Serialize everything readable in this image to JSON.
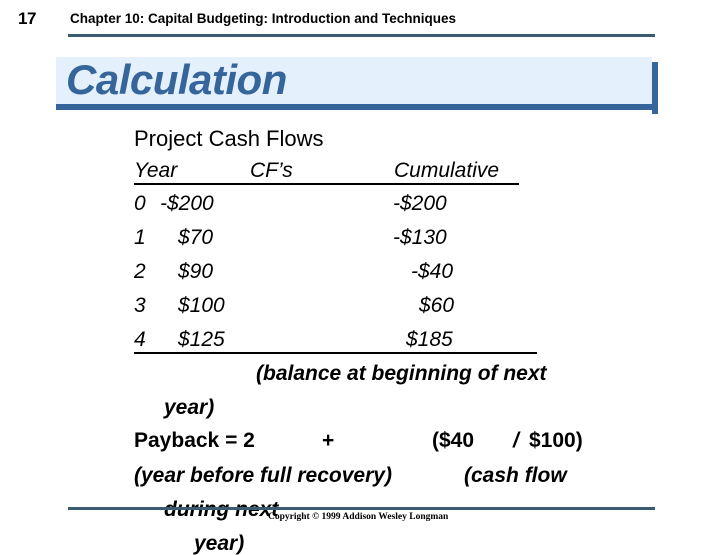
{
  "header": {
    "page_number": "17",
    "title": "Chapter 10: Capital Budgeting: Introduction and Techniques"
  },
  "slide": {
    "title": "Calculation",
    "accent_color": "#35659b",
    "band_fill": "#e4f0fb",
    "rule_color": "#3b5b72"
  },
  "body": {
    "subtitle": "Project Cash Flows",
    "table": {
      "columns": [
        "Year",
        "CF’s",
        "Cumulative"
      ],
      "rows": [
        {
          "year": "0",
          "cf": "-$200",
          "cumulative": "-$200"
        },
        {
          "year": "1",
          "cf": "$70",
          "cumulative": "-$130"
        },
        {
          "year": "2",
          "cf": "$90",
          "cumulative": "-$40"
        },
        {
          "year": "3",
          "cf": "$100",
          "cumulative": "$60"
        },
        {
          "year": "4",
          "cf": "$125",
          "cumulative": "$185"
        }
      ]
    },
    "note_line1": "(balance at beginning of next",
    "note_line2": "year)",
    "payback_label": "Payback = 2",
    "payback_plus": "+",
    "payback_numerator": "($40",
    "payback_slash": "/",
    "payback_denominator": "$100)",
    "explain_left": "(year before full recovery)",
    "explain_right_line1": "(cash flow",
    "explain_right_line2": "during next",
    "explain_right_line3": "year)"
  },
  "footer": {
    "copyright": "Copyright © 1999 Addison Wesley Longman"
  }
}
